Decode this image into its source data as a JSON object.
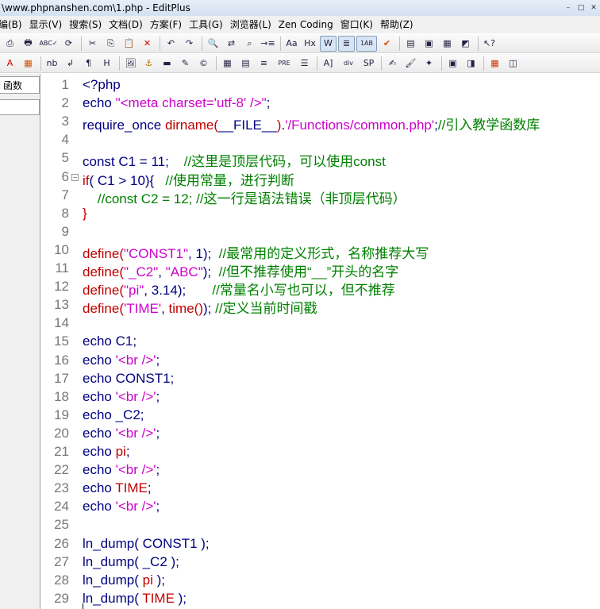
{
  "titlebar": {
    "title": "\\www.phpnanshen.com\\1.php - EditPlus"
  },
  "window_controls": [
    "–",
    "□",
    "✕"
  ],
  "menu": [
    "编(B)",
    "显示(V)",
    "搜索(S)",
    "文档(D)",
    "方案(F)",
    "工具(G)",
    "浏览器(L)",
    "Zen Coding",
    "窗口(K)",
    "帮助(Z)"
  ],
  "toolbar1": [
    {
      "icon": "print-preview-icon",
      "glyph": "⎙"
    },
    {
      "icon": "print-icon",
      "glyph": "🖶"
    },
    {
      "icon": "spell-check-icon",
      "glyph": "ABC✓"
    },
    {
      "icon": "reload-icon",
      "glyph": "⟳"
    },
    {
      "sep": true
    },
    {
      "icon": "cut-icon",
      "glyph": "✂"
    },
    {
      "icon": "copy-icon",
      "glyph": "⎘"
    },
    {
      "icon": "paste-icon",
      "glyph": "📋"
    },
    {
      "icon": "delete-icon",
      "glyph": "✕",
      "color": "#cc0000"
    },
    {
      "sep": true
    },
    {
      "icon": "undo-icon",
      "glyph": "↶"
    },
    {
      "icon": "redo-icon",
      "glyph": "↷"
    },
    {
      "sep": true
    },
    {
      "icon": "find-icon",
      "glyph": "🔍"
    },
    {
      "icon": "replace-icon",
      "glyph": "⇄"
    },
    {
      "icon": "find-in-files-icon",
      "glyph": "⌕"
    },
    {
      "icon": "goto-line-icon",
      "glyph": "→≡"
    },
    {
      "sep": true
    },
    {
      "icon": "font-icon",
      "glyph": "Aа"
    },
    {
      "icon": "hex-icon",
      "glyph": "Hx"
    },
    {
      "icon": "word-wrap-icon",
      "glyph": "W",
      "pressed": true
    },
    {
      "icon": "line-number-icon",
      "glyph": "≣",
      "pressed": true
    },
    {
      "icon": "ruler-icon",
      "glyph": "1AB",
      "pressed": true
    },
    {
      "icon": "check-icon",
      "glyph": "✔",
      "color": "#dd4400"
    },
    {
      "sep": true
    },
    {
      "icon": "window-icon",
      "glyph": "▤"
    },
    {
      "icon": "window2-icon",
      "glyph": "▣"
    },
    {
      "icon": "cliptext-icon",
      "glyph": "▦"
    },
    {
      "icon": "browser-icon",
      "glyph": "◩"
    },
    {
      "sep": true
    },
    {
      "icon": "help-pointer-icon",
      "glyph": "↖?"
    }
  ],
  "toolbar2": [
    {
      "icon": "font-color-icon",
      "glyph": "A",
      "color": "#cc0000"
    },
    {
      "icon": "color-grid-icon",
      "glyph": "▦",
      "color": "#d05000"
    },
    {
      "sep": true
    },
    {
      "icon": "nbsp-icon",
      "glyph": "nb"
    },
    {
      "icon": "br-icon",
      "glyph": "↲"
    },
    {
      "icon": "paragraph-icon",
      "glyph": "¶"
    },
    {
      "icon": "heading-icon",
      "glyph": "H"
    },
    {
      "sep": true
    },
    {
      "icon": "image-icon",
      "glyph": "🖼"
    },
    {
      "icon": "anchor-icon",
      "glyph": "⚓",
      "color": "#b07000"
    },
    {
      "icon": "hr-icon",
      "glyph": "▬"
    },
    {
      "icon": "edit-icon",
      "glyph": "✎"
    },
    {
      "icon": "copyright-icon",
      "glyph": "©"
    },
    {
      "sep": true
    },
    {
      "icon": "table-icon",
      "glyph": "▦"
    },
    {
      "icon": "table2-icon",
      "glyph": "▤"
    },
    {
      "icon": "center-icon",
      "glyph": "≡"
    },
    {
      "icon": "pre-icon",
      "glyph": "PRE"
    },
    {
      "icon": "list-icon",
      "glyph": "☰"
    },
    {
      "sep": true
    },
    {
      "icon": "form-icon",
      "glyph": "A]"
    },
    {
      "icon": "div-icon",
      "glyph": "div"
    },
    {
      "icon": "span-icon",
      "glyph": "SP"
    },
    {
      "sep": true
    },
    {
      "icon": "style-icon",
      "glyph": "✍"
    },
    {
      "icon": "brush-icon",
      "glyph": "🖌"
    },
    {
      "icon": "script-icon",
      "glyph": "✦"
    },
    {
      "sep": true
    },
    {
      "icon": "preview-icon",
      "glyph": "▣"
    },
    {
      "icon": "preview2-icon",
      "glyph": "◨"
    },
    {
      "sep": true
    },
    {
      "icon": "color-palette-icon",
      "glyph": "▦",
      "color": "#cc3300"
    },
    {
      "icon": "frame-icon",
      "glyph": "◫"
    }
  ],
  "sidebar": {
    "tab_label": "函数"
  },
  "editor": {
    "lines": [
      [
        [
          "k",
          "<?php"
        ]
      ],
      [
        [
          "k",
          "echo "
        ],
        [
          "s",
          "\"<meta charset='utf-8' />\""
        ],
        [
          "k",
          ";"
        ]
      ],
      [
        [
          "k",
          "require_once "
        ],
        [
          "f",
          "dirname("
        ],
        [
          "k",
          "__FILE__"
        ],
        [
          "f",
          ")"
        ],
        [
          "k",
          "."
        ],
        [
          "s",
          "'/Functions/common.php'"
        ],
        [
          "k",
          ";"
        ],
        [
          "c",
          "//引入教学函数库"
        ]
      ],
      [],
      [
        [
          "k",
          "const C1 = 11;    "
        ],
        [
          "c",
          "//这里是顶层代码，可以使用const"
        ]
      ],
      [
        [
          "f",
          "if"
        ],
        [
          "k",
          "( C1 > 10){   "
        ],
        [
          "c",
          "//使用常量，进行判断"
        ]
      ],
      [
        [
          "c",
          "    //const C2 = 12; //这一行是语法错误（非顶层代码）"
        ]
      ],
      [
        [
          "f",
          "}"
        ]
      ],
      [],
      [
        [
          "f",
          "define("
        ],
        [
          "s",
          "\"CONST1\""
        ],
        [
          "k",
          ", 1);  "
        ],
        [
          "c",
          "//最常用的定义形式，名称推荐大写"
        ]
      ],
      [
        [
          "f",
          "define("
        ],
        [
          "s",
          "\"_C2\""
        ],
        [
          "k",
          ", "
        ],
        [
          "s",
          "\"ABC\""
        ],
        [
          "k",
          ");  "
        ],
        [
          "c",
          "//但不推荐使用“__”开头的名字"
        ]
      ],
      [
        [
          "f",
          "define("
        ],
        [
          "s",
          "\"pi\""
        ],
        [
          "k",
          ", 3.14);       "
        ],
        [
          "c",
          "//常量名小写也可以，但不推荐"
        ]
      ],
      [
        [
          "f",
          "define("
        ],
        [
          "s",
          "'TIME'"
        ],
        [
          "k",
          ", "
        ],
        [
          "f",
          "time()"
        ],
        [
          "k",
          "); "
        ],
        [
          "c",
          "//定义当前时间戳"
        ]
      ],
      [],
      [
        [
          "k",
          "echo C1;"
        ]
      ],
      [
        [
          "k",
          "echo "
        ],
        [
          "s",
          "'<br />'"
        ],
        [
          "k",
          ";"
        ]
      ],
      [
        [
          "k",
          "echo CONST1;"
        ]
      ],
      [
        [
          "k",
          "echo "
        ],
        [
          "s",
          "'<br />'"
        ],
        [
          "k",
          ";"
        ]
      ],
      [
        [
          "k",
          "echo _C2;"
        ]
      ],
      [
        [
          "k",
          "echo "
        ],
        [
          "s",
          "'<br />'"
        ],
        [
          "k",
          ";"
        ]
      ],
      [
        [
          "k",
          "echo "
        ],
        [
          "f",
          "pi"
        ],
        [
          "k",
          ";"
        ]
      ],
      [
        [
          "k",
          "echo "
        ],
        [
          "s",
          "'<br />'"
        ],
        [
          "k",
          ";"
        ]
      ],
      [
        [
          "k",
          "echo "
        ],
        [
          "f",
          "TIME"
        ],
        [
          "k",
          ";"
        ]
      ],
      [
        [
          "k",
          "echo "
        ],
        [
          "s",
          "'<br />'"
        ],
        [
          "k",
          ";"
        ]
      ],
      [],
      [
        [
          "k",
          "ln_dump( CONST1 );"
        ]
      ],
      [
        [
          "k",
          "ln_dump( _C2 );"
        ]
      ],
      [
        [
          "k",
          "ln_dump( "
        ],
        [
          "f",
          "pi"
        ],
        [
          "k",
          " );"
        ]
      ],
      [
        [
          "k",
          "ln_dump( "
        ],
        [
          "f",
          "TIME"
        ],
        [
          "k",
          " );"
        ]
      ]
    ]
  }
}
